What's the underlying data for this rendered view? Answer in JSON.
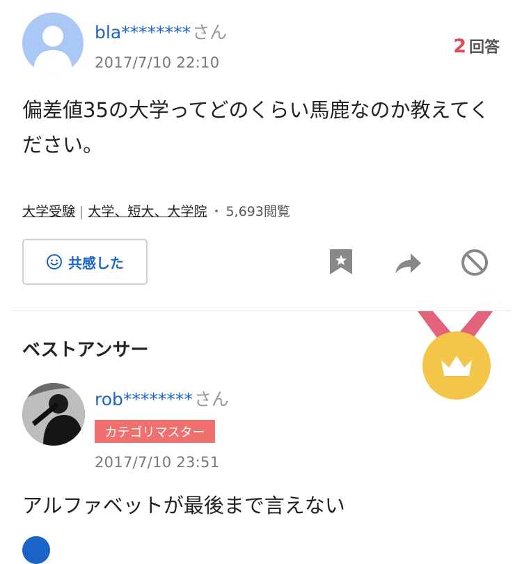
{
  "question": {
    "username": "bla********",
    "honorific": "さん",
    "datetime": "2017/7/10 22:10",
    "answer_count": "2",
    "answer_count_label": "回答",
    "body": "偏差値35の大学ってどのくらい馬鹿なのか教えてください。",
    "tags": [
      "大学受験",
      "大学、短大、大学院"
    ],
    "tag_separator": "|",
    "views_prefix": "・",
    "views": "5,693閲覧"
  },
  "actions": {
    "empathy_label": "共感した",
    "icons": [
      "smile-icon",
      "bookmark-icon",
      "share-icon",
      "block-icon"
    ]
  },
  "best_answer": {
    "section_title": "ベストアンサー",
    "username": "rob********",
    "honorific": "さん",
    "badge": "カテゴリマスター",
    "datetime": "2017/7/10 23:51",
    "body": "アルファベットが最後まで言えない",
    "icon": "medal-crown-icon"
  },
  "colors": {
    "link_blue": "#1a64c8",
    "answer_count_red": "#e04a5a",
    "badge_red": "#f07070",
    "medal_gold": "#f3c64a",
    "ribbon_red": "#e2637a"
  }
}
